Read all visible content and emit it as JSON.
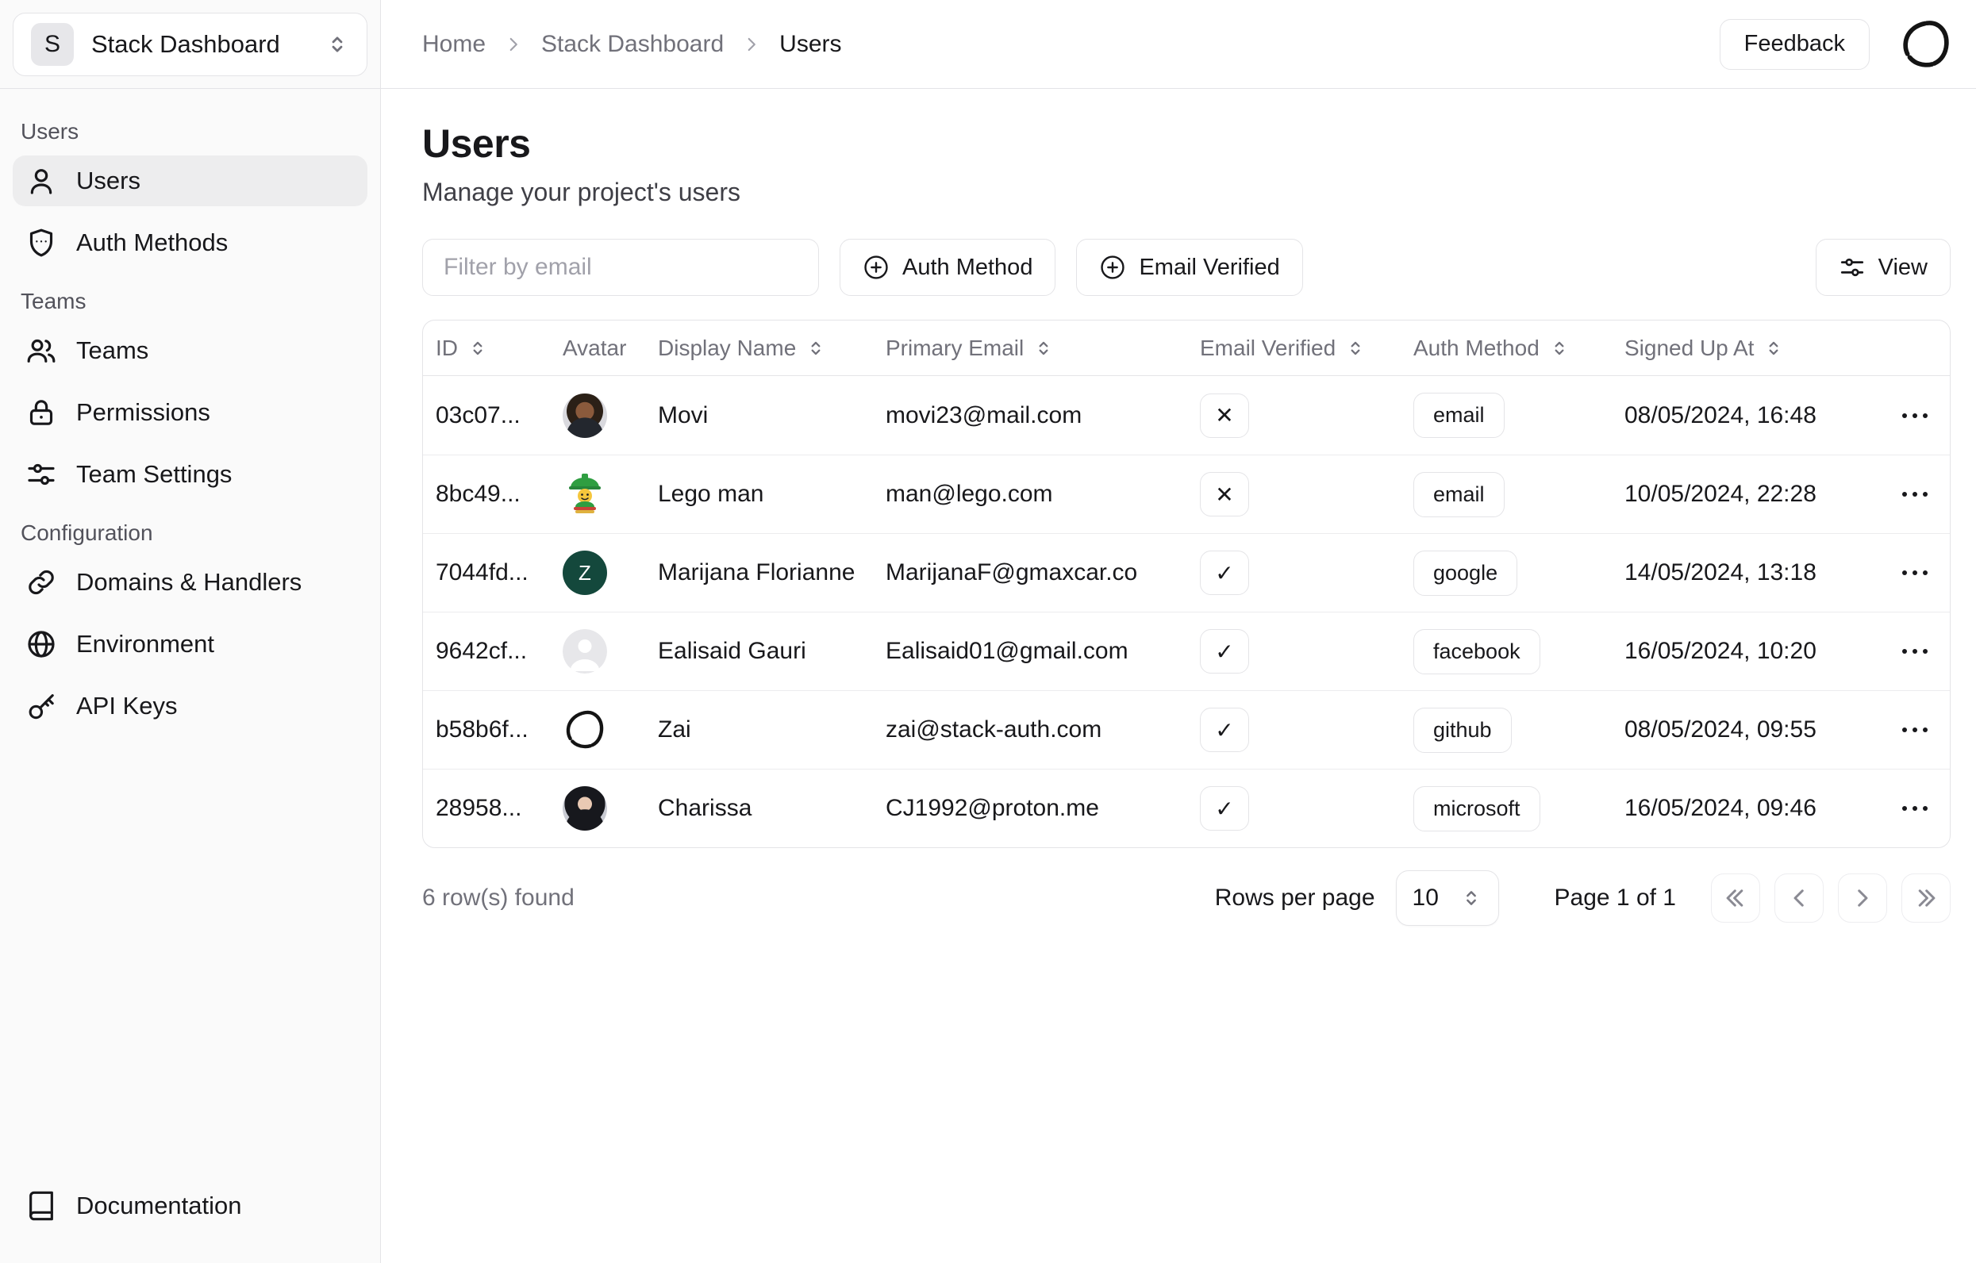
{
  "app": {
    "project_initial": "S",
    "project_name": "Stack Dashboard"
  },
  "topbar": {
    "breadcrumb": [
      {
        "label": "Home"
      },
      {
        "label": "Stack Dashboard"
      },
      {
        "label": "Users"
      }
    ],
    "feedback_label": "Feedback"
  },
  "sidebar": {
    "sections": [
      {
        "label": "Users",
        "items": [
          {
            "label": "Users",
            "icon": "user-icon",
            "active": true
          },
          {
            "label": "Auth Methods",
            "icon": "shield-icon",
            "active": false
          }
        ]
      },
      {
        "label": "Teams",
        "items": [
          {
            "label": "Teams",
            "icon": "people-icon",
            "active": false
          },
          {
            "label": "Permissions",
            "icon": "lock-icon",
            "active": false
          },
          {
            "label": "Team Settings",
            "icon": "sliders-icon",
            "active": false
          }
        ]
      },
      {
        "label": "Configuration",
        "items": [
          {
            "label": "Domains & Handlers",
            "icon": "link-icon",
            "active": false
          },
          {
            "label": "Environment",
            "icon": "globe-icon",
            "active": false
          },
          {
            "label": "API Keys",
            "icon": "key-icon",
            "active": false
          }
        ]
      }
    ],
    "footer_item": {
      "label": "Documentation",
      "icon": "book-icon"
    }
  },
  "page": {
    "title": "Users",
    "subtitle": "Manage your project's users"
  },
  "filters": {
    "search_placeholder": "Filter by email",
    "auth_method_label": "Auth Method",
    "email_verified_label": "Email Verified",
    "view_label": "View"
  },
  "glyphs": {
    "verified": "✓",
    "unverified": "✕"
  },
  "table": {
    "columns": [
      {
        "label": "ID",
        "sortable": true
      },
      {
        "label": "Avatar",
        "sortable": false
      },
      {
        "label": "Display Name",
        "sortable": true
      },
      {
        "label": "Primary Email",
        "sortable": true
      },
      {
        "label": "Email Verified",
        "sortable": true
      },
      {
        "label": "Auth Method",
        "sortable": true
      },
      {
        "label": "Signed Up At",
        "sortable": true
      }
    ],
    "rows": [
      {
        "id": "03c07...",
        "avatar": "photo-male",
        "display_name": "Movi",
        "primary_email": "movi23@mail.com",
        "email_verified": false,
        "auth_method": "email",
        "signed_up_at": "08/05/2024, 16:48"
      },
      {
        "id": "8bc49...",
        "avatar": "lego",
        "display_name": "Lego man",
        "primary_email": "man@lego.com",
        "email_verified": false,
        "auth_method": "email",
        "signed_up_at": "10/05/2024, 22:28"
      },
      {
        "id": "7044fd...",
        "avatar": "initial",
        "avatar_initial": "Z",
        "avatar_color": "#14483c",
        "display_name": "Marijana Florianne",
        "primary_email": "MarijanaF@gmaxcar.co",
        "email_verified": true,
        "auth_method": "google",
        "signed_up_at": "14/05/2024, 13:18"
      },
      {
        "id": "9642cf...",
        "avatar": "placeholder",
        "display_name": "Ealisaid Gauri",
        "primary_email": "Ealisaid01@gmail.com",
        "email_verified": true,
        "auth_method": "facebook",
        "signed_up_at": "16/05/2024, 10:20"
      },
      {
        "id": "b58b6f...",
        "avatar": "ink",
        "display_name": "Zai",
        "primary_email": "zai@stack-auth.com",
        "email_verified": true,
        "auth_method": "github",
        "signed_up_at": "08/05/2024, 09:55"
      },
      {
        "id": "28958...",
        "avatar": "photo-female",
        "display_name": "Charissa",
        "primary_email": "CJ1992@proton.me",
        "email_verified": true,
        "auth_method": "microsoft",
        "signed_up_at": "16/05/2024, 09:46"
      }
    ],
    "footer": {
      "rows_found": "6 row(s) found",
      "rows_per_page_label": "Rows per page",
      "rows_per_page_value": "10",
      "page_status": "Page 1 of 1"
    }
  }
}
